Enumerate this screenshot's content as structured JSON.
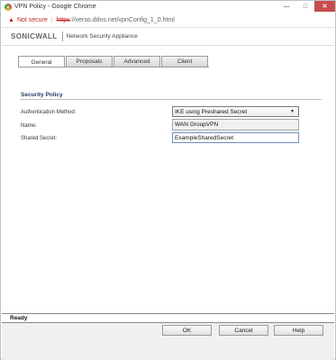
{
  "window": {
    "title": "VPN Policy - Google Chrome",
    "minimize_glyph": "—",
    "maximize_glyph": "□",
    "close_glyph": "✕"
  },
  "address_bar": {
    "warning_icon": "▲",
    "security_label": "Not secure",
    "separator": "|",
    "scheme": "https",
    "url_rest": "://verso.ddns.net/vpnConfig_1_0.html"
  },
  "header": {
    "logo": "SONICWALL",
    "subtitle": "Network Security Appliance"
  },
  "tabs": [
    {
      "label": "General",
      "active": true
    },
    {
      "label": "Proposals",
      "active": false
    },
    {
      "label": "Advanced",
      "active": false
    },
    {
      "label": "Client",
      "active": false
    }
  ],
  "security_policy": {
    "title": "Security Policy",
    "auth_method_label": "Authentication Method:",
    "auth_method_value": "IKE using Preshared Secret",
    "dropdown_arrow": "▼",
    "name_label": "Name:",
    "name_value": "WAN GroupVPN",
    "secret_label": "Shared Secret:",
    "secret_value": "ExampleSharedSecret"
  },
  "status": {
    "text": "Ready"
  },
  "buttons": {
    "ok": "OK",
    "cancel": "Cancel",
    "help": "Help"
  },
  "colors": {
    "close_button": "#c74d4d",
    "insecure_red": "#c5221f",
    "section_title": "#1f3b66",
    "footer_bg": "#f0f0f0"
  }
}
